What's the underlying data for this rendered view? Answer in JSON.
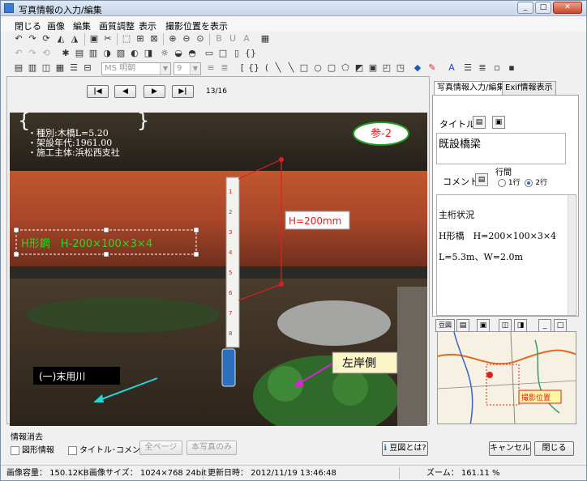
{
  "window": {
    "title": "写真情報の入力/編集",
    "controls": [
      "_",
      "□",
      "✕"
    ]
  },
  "menu": [
    "閉じる",
    "画像",
    "編集",
    "画質調整",
    "表示",
    "撮影位置を表示"
  ],
  "toolbar": {
    "font_name": "MS 明朝",
    "font_size": "9"
  },
  "nav": {
    "first": "|◀",
    "prev": "◀",
    "next": "▶",
    "last": "▶|",
    "page": "13/16"
  },
  "photo": {
    "info_lines": [
      "・種別:木橋L=5.20",
      "・架設年代:1961.00",
      "・施工主体:浜松西支社"
    ],
    "badge": "参-2",
    "dimension": "H=200mm",
    "member_label": "H形鋼　H-200×100×3×4",
    "river_label": "(一)末用川",
    "bank_label": "左岸側",
    "tape_marks": [
      "1",
      "2",
      "3",
      "4",
      "5",
      "6",
      "7",
      "8"
    ]
  },
  "right_panel": {
    "tabs": [
      "写真情報入力/編集",
      "Exif情報表示"
    ],
    "title_label": "タイトル",
    "title_value": "既設橋梁",
    "comment_label": "コメント",
    "line_spacing_label": "行間",
    "line_options": [
      "1行",
      "2行"
    ],
    "comment_lines": [
      "主桁状況",
      "H形橋　H=200×100×3×4",
      "L=5.3m、W=2.0m"
    ],
    "map_toolbar_label": "豆図",
    "map_marker": "撮影位置"
  },
  "bottom": {
    "group_label": "情報消去",
    "check_figure": "図形情報",
    "check_title": "タイトル･コメント情報",
    "btn_all": "全ページ",
    "btn_this": "本写真のみ",
    "btn_help": "豆図とは?",
    "btn_cancel": "キャンセル",
    "btn_close": "閉じる"
  },
  "status": {
    "size": "画像容量： 150.12KB",
    "dims": "画像サイズ： 1024×768 24bit",
    "updated": "更新日時： 2012/11/19 13:46:48",
    "zoom": "ズーム： 161.11 %"
  },
  "colors": {
    "steel_beam": "#b04a2a",
    "label_green": "#22dd22",
    "dim_red": "#e02020",
    "bank_label_bg": "#fcf5c8",
    "arrow_cyan": "#26d7d7",
    "arrow_magenta": "#d524d5"
  }
}
